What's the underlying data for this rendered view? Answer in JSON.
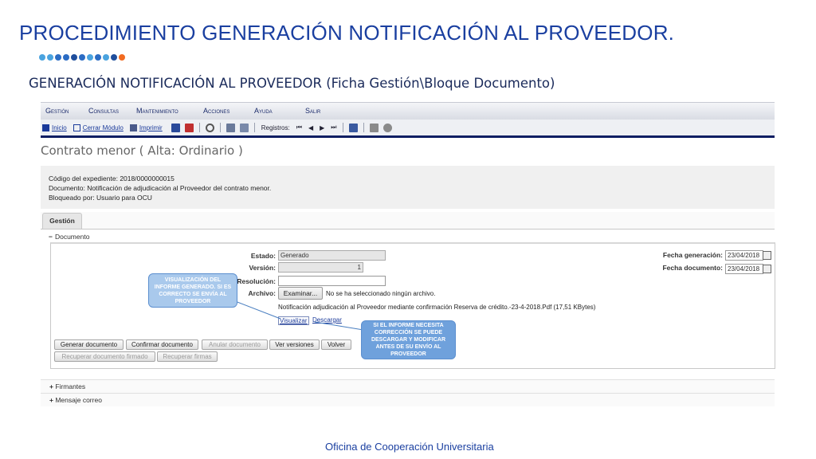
{
  "slide": {
    "title": "PROCEDIMIENTO GENERACIÓN NOTIFICACIÓN AL PROVEEDOR",
    "title_dot": ".",
    "subtitle": "GENERACIÓN NOTIFICACIÓN AL PROVEEDOR (Ficha Gestión\\Bloque Documento)",
    "footer": "Oficina de Cooperación Universitaria",
    "dot_colors": [
      "#4aa3df",
      "#4aa3df",
      "#2b6cc4",
      "#2b6cc4",
      "#1f4e9c",
      "#2b6cc4",
      "#4aa3df",
      "#2b6cc4",
      "#4aa3df",
      "#1f4e9c",
      "#f26b21"
    ]
  },
  "menu": [
    "Gestión",
    "Consultas",
    "Mantenimiento",
    "Acciones",
    "Ayuda",
    "Salir"
  ],
  "toolbar": {
    "inicio": "Inicio",
    "cerrar": "Cerrar Módulo",
    "imprimir": "Imprimir",
    "registros": "Registros:"
  },
  "page_heading": "Contrato menor ( Alta: Ordinario )",
  "info": {
    "line1": "Código del expediente: 2018/0000000015",
    "line2": "Documento: Notificación de adjudicación al Proveedor del contrato menor.",
    "line3": "Bloqueado por: Usuario para OCU"
  },
  "tab": "Gestión",
  "section": {
    "toggle": "−",
    "label": "Documento"
  },
  "form": {
    "estado_label": "Estado:",
    "estado_value": "Generado",
    "version_label": "Versión:",
    "version_value": "1",
    "resolucion_label": "Resolución:",
    "resolucion_value": "",
    "archivo_label": "Archivo:",
    "examinar": "Examinar...",
    "no_file": "No se ha seleccionado ningún archivo.",
    "file_name": "Notificación adjudicación al Proveedor mediante confirmación Reserva de crédito.-23-4-2018.Pdf (17,51 KBytes)",
    "visualizar": "Visualizar",
    "descargar": "Descargar",
    "fecha_gen_label": "Fecha generación:",
    "fecha_gen_value": "23/04/2018",
    "fecha_doc_label": "Fecha documento:",
    "fecha_doc_value": "23/04/2018"
  },
  "buttons": {
    "generar": "Generar documento",
    "confirmar": "Confirmar documento",
    "anular": "Anular documento",
    "versiones": "Ver versiones",
    "volver": "Volver",
    "recuperar_doc": "Recuperar documento firmado",
    "recuperar_firmas": "Recuperar firmas"
  },
  "callouts": {
    "left": "VISUALIZACIÓN DEL INFORME GENERADO. SI ES CORRECTO SE ENVÍA AL PROVEEDOR",
    "right": "SI EL INFORME NECESITA CORRECCIÓN SE PUEDE DESCARGAR Y MODIFICAR ANTES DE SU ENVÍO AL PROVEEDOR"
  },
  "collapsed": {
    "toggle": "+",
    "firmantes": "Firmantes",
    "mensaje": "Mensaje correo"
  }
}
